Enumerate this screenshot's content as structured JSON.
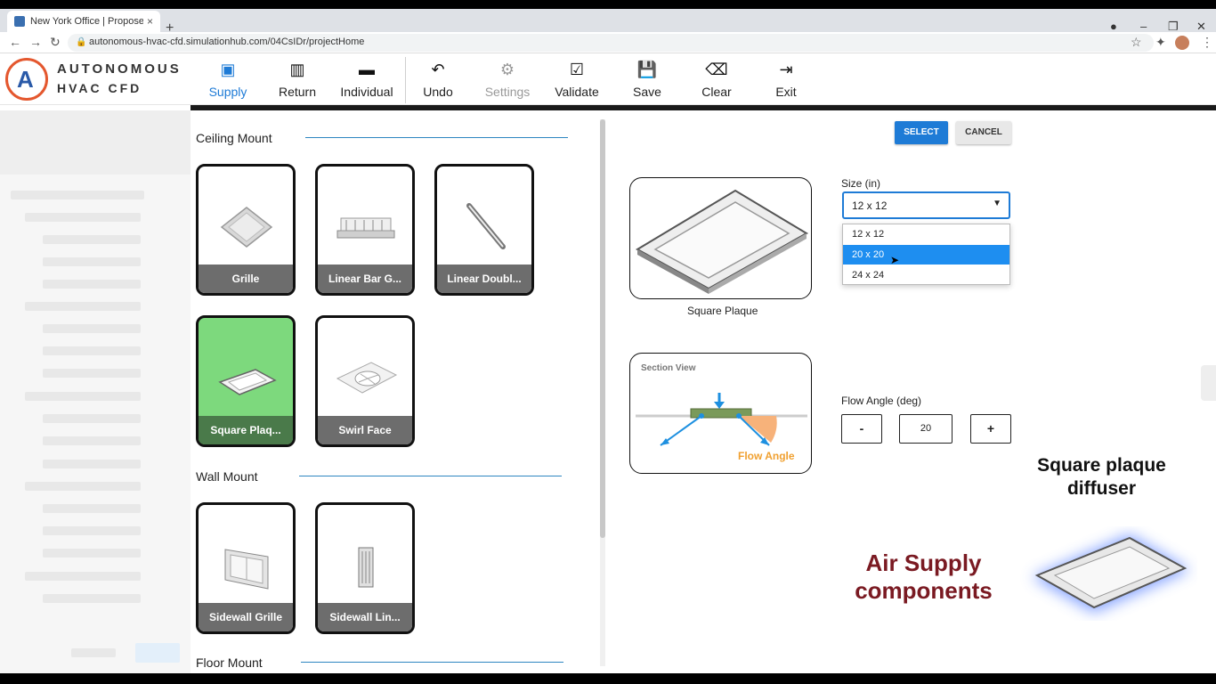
{
  "browser": {
    "tab_title": "New York Office | Proposed Desi",
    "tab_close": "×",
    "new_tab": "+",
    "url": "autonomous-hvac-cfd.simulationhub.com/04CsIDr/projectHome"
  },
  "app": {
    "brand_line1": "AUTONOMOUS",
    "brand_line2": "HVAC CFD",
    "logo_letter": "A"
  },
  "toolbar": {
    "items": [
      {
        "label": "Supply",
        "icon": "supply-icon"
      },
      {
        "label": "Return",
        "icon": "return-icon"
      },
      {
        "label": "Individual",
        "icon": "individual-icon"
      },
      {
        "label": "Undo",
        "icon": "undo-icon"
      },
      {
        "label": "Settings",
        "icon": "gear-icon"
      },
      {
        "label": "Validate",
        "icon": "check-icon"
      },
      {
        "label": "Save",
        "icon": "save-icon"
      },
      {
        "label": "Clear",
        "icon": "eraser-icon"
      },
      {
        "label": "Exit",
        "icon": "exit-icon"
      }
    ]
  },
  "picker": {
    "ceiling_heading": "Ceiling Mount",
    "wall_heading": "Wall Mount",
    "floor_heading": "Floor Mount",
    "ceiling_items": [
      "Grille",
      "Linear Bar G...",
      "Linear Doubl...",
      "Square Plaq...",
      "Swirl Face"
    ],
    "wall_items": [
      "Sidewall Grille",
      "Sidewall Lin..."
    ]
  },
  "detail": {
    "select_label": "SELECT",
    "cancel_label": "CANCEL",
    "preview_caption": "Square Plaque",
    "section_view_label": "Section View",
    "flow_angle_label": "Flow Angle",
    "size_label": "Size (in)",
    "size_value": "12 x 12",
    "size_options": [
      "12 x 12",
      "20 x 20",
      "24 x 24"
    ],
    "highlighted_option": "20 x 20",
    "flow_angle_field_label": "Flow Angle (deg)",
    "flow_angle_value": "20",
    "minus": "-",
    "plus": "+"
  },
  "annotations": {
    "product_title": "Square plaque diffuser",
    "overlay_title": "Air Supply components"
  },
  "colors": {
    "accent": "#1e7bd6",
    "selected_card": "#7dd97d",
    "annotation_red": "#7a1a22"
  }
}
